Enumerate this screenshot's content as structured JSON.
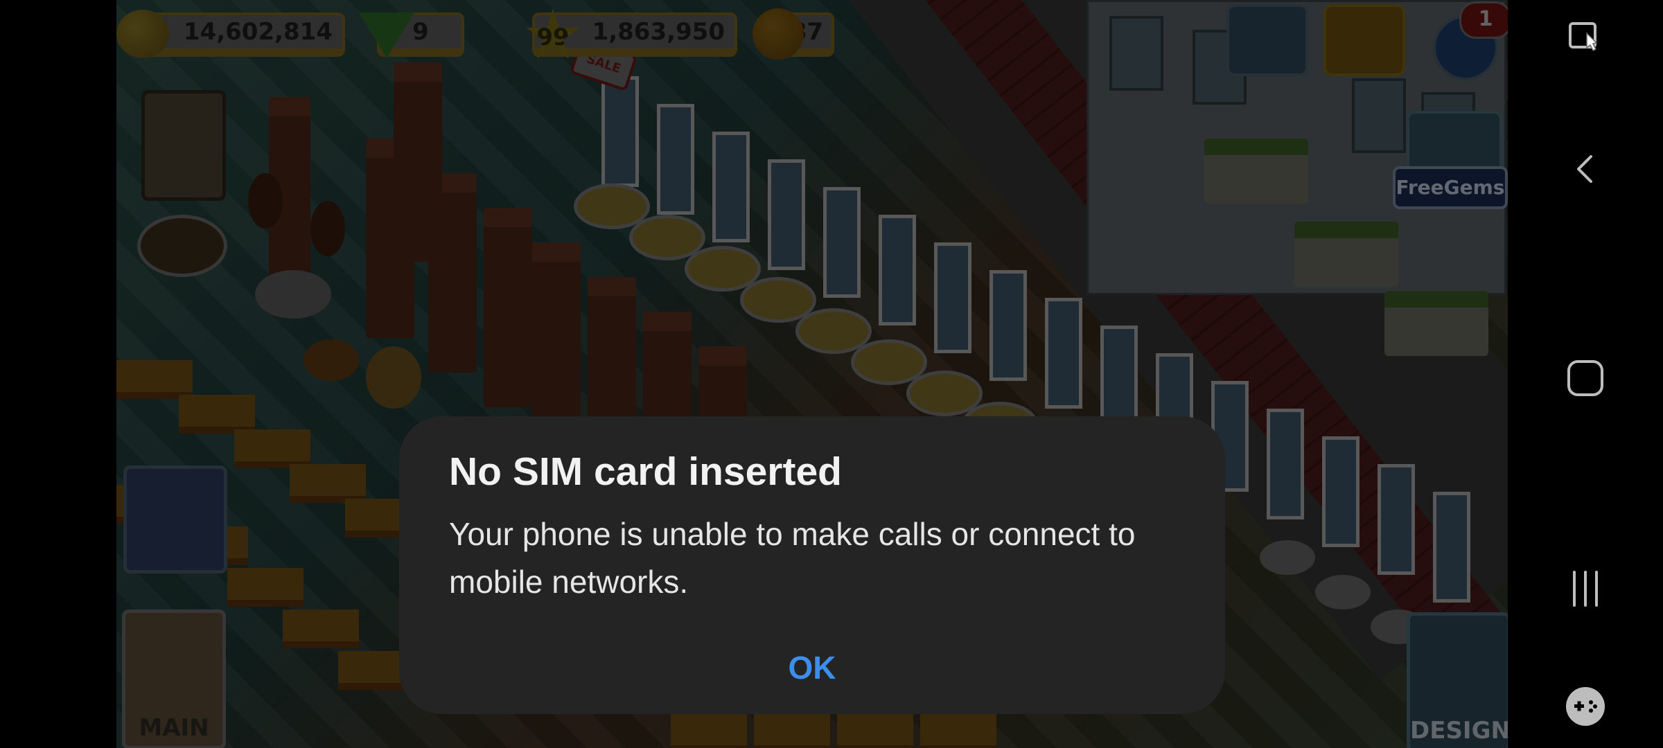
{
  "hud": {
    "coins": "14,602,814",
    "gems": "9",
    "level": "99",
    "experience": "1,863,950",
    "happiness": "87",
    "sale_tag": "SALE",
    "notification_count": "1",
    "free_gems_label": "FreeGems"
  },
  "side_buttons": {
    "main_label": "MAIN",
    "design_label": "DESIGN"
  },
  "dialog": {
    "title": "No SIM card inserted",
    "message": "Your phone is unable to make calls or connect to mobile networks.",
    "ok_label": "OK"
  },
  "navbar": {
    "icons": [
      "screen-capture-icon",
      "back-icon",
      "home-icon",
      "recents-icon",
      "game-tools-icon"
    ]
  },
  "colors": {
    "dialog_bg": "#242424",
    "ok_accent": "#3d8eea",
    "navbar_bg": "#000000"
  }
}
